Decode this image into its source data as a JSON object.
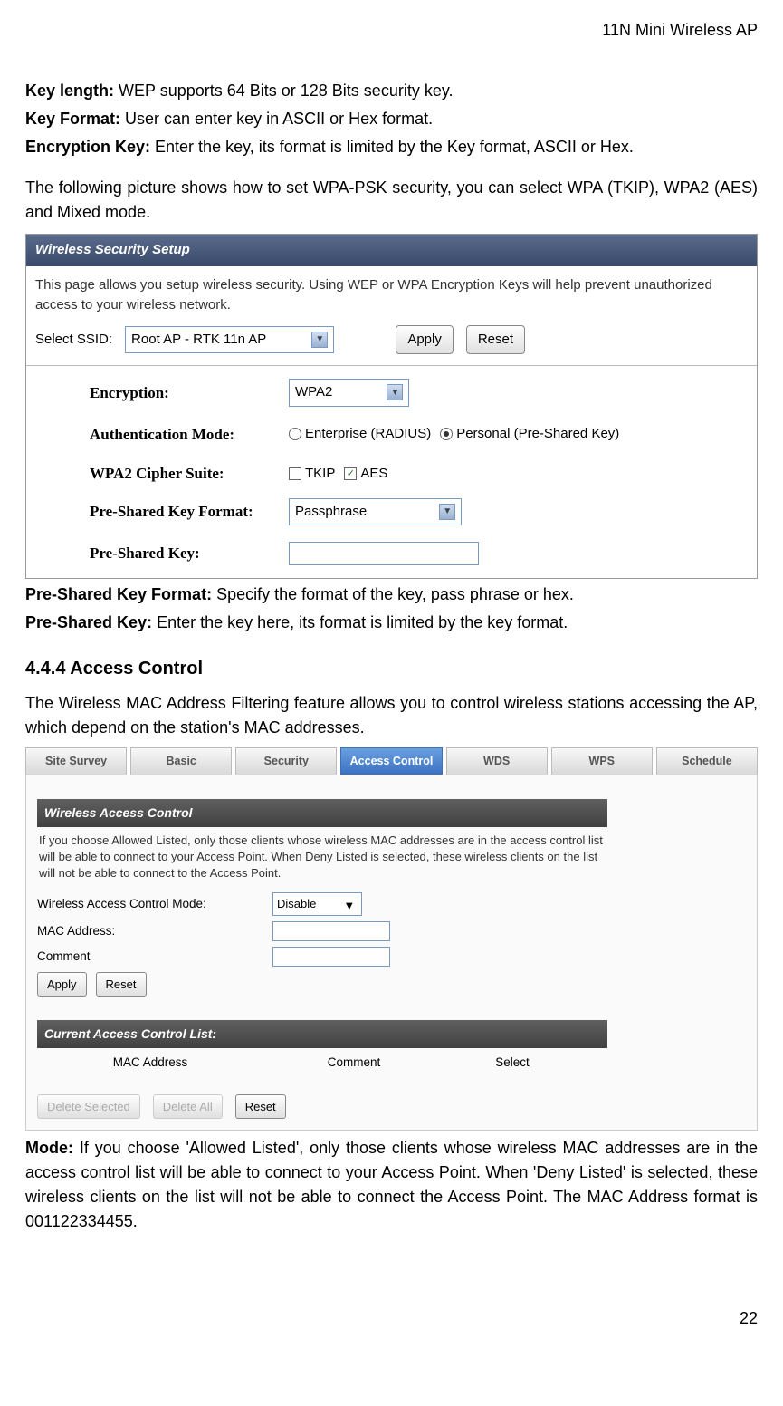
{
  "header": {
    "title": "11N Mini Wireless AP"
  },
  "defs": {
    "keyLengthLabel": "Key length:",
    "keyLengthText": " WEP supports 64 Bits or 128 Bits security key.",
    "keyFormatLabel": "Key Format:",
    "keyFormatText": " User can enter key in ASCII or Hex format.",
    "encKeyLabel": "Encryption Key:",
    "encKeyText": " Enter the key, its format is limited by the Key format, ASCII or Hex."
  },
  "para1": "The following picture shows how to set WPA-PSK security, you can select WPA (TKIP), WPA2 (AES) and Mixed mode.",
  "ss1": {
    "title": "Wireless Security Setup",
    "desc": "This page allows you setup wireless security. Using WEP or WPA Encryption Keys will help prevent unauthorized access to your wireless network.",
    "selectSsidLabel": "Select SSID:",
    "ssidValue": "Root AP - RTK 11n AP",
    "apply": "Apply",
    "reset": "Reset",
    "encryptionLabel": "Encryption:",
    "encryptionValue": "WPA2",
    "authModeLabel": "Authentication Mode:",
    "authOpt1": "Enterprise (RADIUS)",
    "authOpt2": "Personal (Pre-Shared Key)",
    "cipherLabel": "WPA2 Cipher Suite:",
    "cipherOpt1": "TKIP",
    "cipherOpt2": "AES",
    "pskFormatLabel": "Pre-Shared Key Format:",
    "pskFormatValue": "Passphrase",
    "pskKeyLabel": "Pre-Shared Key:"
  },
  "defs2": {
    "pskFormatLabel": "Pre-Shared Key Format:",
    "pskFormatText": " Specify the format of the key, pass phrase or hex.",
    "pskKeyLabel": "Pre-Shared Key:",
    "pskKeyText": " Enter the key here, its format is limited by the key format."
  },
  "heading": "4.4.4 Access Control",
  "para2": "The Wireless MAC Address Filtering feature allows you to control wireless stations accessing the AP, which depend on the station's MAC addresses.",
  "ss2": {
    "tabs": [
      "Site Survey",
      "Basic",
      "Security",
      "Access Control",
      "WDS",
      "WPS",
      "Schedule"
    ],
    "activeTab": 3,
    "panelTitle": "Wireless Access Control",
    "desc": "If you choose Allowed Listed, only those clients whose wireless MAC addresses are in the access control list will be able to connect to your Access Point. When Deny Listed is selected, these wireless clients on the list will not be able to connect to the Access Point.",
    "modeLabel": "Wireless Access Control Mode:",
    "modeValue": "Disable",
    "macLabel": "MAC Address:",
    "commentLabel": "Comment",
    "apply": "Apply",
    "reset": "Reset",
    "listTitle": "Current Access Control List:",
    "col1": "MAC Address",
    "col2": "Comment",
    "col3": "Select",
    "deleteSelected": "Delete Selected",
    "deleteAll": "Delete All",
    "reset2": "Reset"
  },
  "defs3": {
    "modeLabel": "Mode:",
    "modeText": " If you choose 'Allowed Listed', only those clients whose wireless MAC addresses are in the access control list will be able to connect to your Access Point. When 'Deny Listed' is selected, these wireless clients on the list will not be able to connect the Access Point. The MAC Address format is 001122334455."
  },
  "footer": {
    "pageNum": "22"
  }
}
